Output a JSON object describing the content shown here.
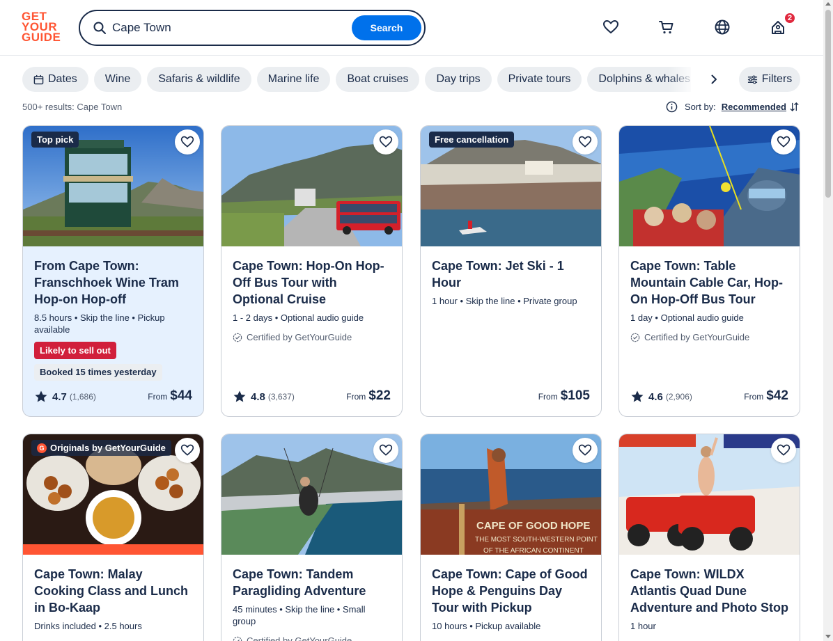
{
  "logo": {
    "line1": "GET",
    "line2": "YOUR",
    "line3": "GUIDE"
  },
  "search": {
    "value": "Cape Town",
    "button": "Search"
  },
  "header": {
    "cart_badge": "2"
  },
  "chips": [
    "Dates",
    "Wine",
    "Safaris & wildlife",
    "Marine life",
    "Boat cruises",
    "Day trips",
    "Private tours",
    "Dolphins & whales"
  ],
  "filters_label": "Filters",
  "results_text": "500+ results: Cape Town",
  "sort": {
    "label": "Sort by:",
    "value": "Recommended"
  },
  "cards": [
    {
      "tag": "Top pick",
      "title": "From Cape Town: Franschhoek Wine Tram Hop-on Hop-off",
      "meta": "8.5 hours • Skip the line • Pickup available",
      "likely": "Likely to sell out",
      "booked": "Booked 15 times yesterday",
      "rating": "4.7",
      "count": "(1,686)",
      "from": "From",
      "price": "$44"
    },
    {
      "title": "Cape Town: Hop-On Hop-Off Bus Tour with Optional Cruise",
      "meta": "1 - 2 days • Optional audio guide",
      "cert": "Certified by GetYourGuide",
      "rating": "4.8",
      "count": "(3,637)",
      "from": "From",
      "price": "$22"
    },
    {
      "tag": "Free cancellation",
      "title": "Cape Town: Jet Ski - 1 Hour",
      "meta": "1 hour • Skip the line • Private group",
      "from": "From",
      "price": "$105"
    },
    {
      "title": "Cape Town: Table Mountain Cable Car, Hop-On Hop-Off Bus Tour",
      "meta": "1 day • Optional audio guide",
      "cert": "Certified by GetYourGuide",
      "rating": "4.6",
      "count": "(2,906)",
      "from": "From",
      "price": "$42"
    },
    {
      "tag": "Originals by GetYourGuide",
      "title": "Cape Town: Malay Cooking Class and Lunch in Bo-Kaap",
      "meta": "Drinks included • 2.5 hours"
    },
    {
      "title": "Cape Town: Tandem Paragliding Adventure",
      "meta": "45 minutes • Skip the line • Small group",
      "cert": "Certified by GetYourGuide"
    },
    {
      "title": "Cape Town: Cape of Good Hope & Penguins Day Tour with Pickup",
      "meta": "10 hours • Pickup available",
      "sign": {
        "line1": "CAPE OF GOOD HOPE",
        "line2": "THE MOST SOUTH-WESTERN POINT",
        "line3": "OF THE AFRICAN CONTINENT"
      }
    },
    {
      "title": "Cape Town: WILDX Atlantis Quad Dune Adventure and Photo Stop",
      "meta": "1 hour"
    }
  ]
}
